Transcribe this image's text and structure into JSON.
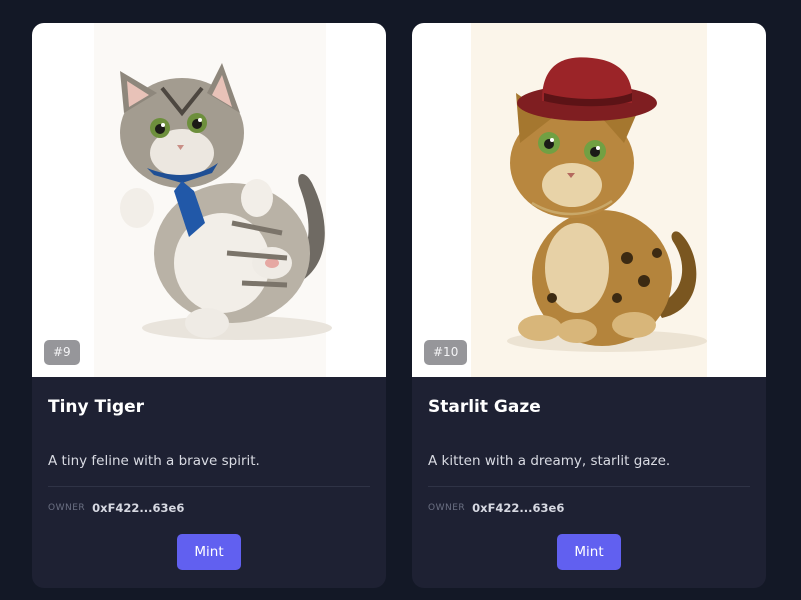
{
  "nfts": [
    {
      "badge": "#9",
      "title": "Tiny Tiger",
      "description": "A tiny feline with a brave spirit.",
      "owner_label": "OWNER",
      "owner_address": "0xF422...63e6",
      "mint_label": "Mint"
    },
    {
      "badge": "#10",
      "title": "Starlit Gaze",
      "description": "A kitten with a dreamy, starlit gaze.",
      "owner_label": "OWNER",
      "owner_address": "0xF422...63e6",
      "mint_label": "Mint"
    }
  ],
  "colors": {
    "page_bg": "#131826",
    "card_bg": "#1e2133",
    "accent": "#6160f0"
  }
}
